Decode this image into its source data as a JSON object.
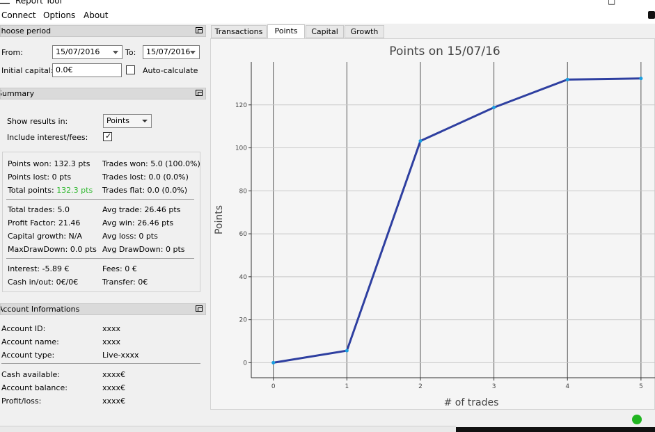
{
  "window": {
    "title": "Report Tool"
  },
  "menu": {
    "items": [
      "Connect",
      "Options",
      "About"
    ]
  },
  "choose_period": {
    "header": "Choose period",
    "from_label": "From:",
    "from_value": "15/07/2016",
    "to_label": "To:",
    "to_value": "15/07/2016",
    "capital_label": "Initial capital:",
    "capital_value": "0.0€",
    "auto_label": "Auto-calculate",
    "auto_checked": false
  },
  "summary": {
    "header": "Summary",
    "show_label": "Show results in:",
    "show_value": "Points",
    "include_label": "Include interest/fees:",
    "include_checked": true,
    "points_won": "Points won: 132.3 pts",
    "points_lost": "Points lost: 0 pts",
    "total_points_label": "Total points:",
    "total_points_value": "132.3 pts",
    "trades_won": "Trades won: 5.0 (100.0%)",
    "trades_lost": "Trades lost: 0.0 (0.0%)",
    "trades_flat": "Trades flat: 0.0 (0.0%)",
    "total_trades": "Total trades: 5.0",
    "profit_factor": "Profit Factor: 21.46",
    "capital_growth": "Capital growth: N/A",
    "max_drawdown": "MaxDrawDown: 0.0 pts",
    "avg_trade": "Avg trade: 26.46 pts",
    "avg_win": "Avg win: 26.46 pts",
    "avg_loss": "Avg loss: 0 pts",
    "avg_drawdown": "Avg DrawDown: 0 pts",
    "interest": "Interest: -5.89 €",
    "cash_in_out": "Cash in/out: 0€/0€",
    "fees": "Fees: 0 €",
    "transfer": "Transfer: 0€",
    "green_color": "#2eb82e"
  },
  "account": {
    "header": "Account Informations",
    "rows": [
      {
        "label": "Account ID:",
        "value": "xxxx"
      },
      {
        "label": "Account name:",
        "value": "xxxx"
      },
      {
        "label": "Account type:",
        "value": "Live-xxxx"
      },
      {
        "label": "Cash available:",
        "value": "xxxx€"
      },
      {
        "label": "Account balance:",
        "value": "xxxx€"
      },
      {
        "label": "Profit/loss:",
        "value": "xxxx€"
      }
    ]
  },
  "tabs": [
    {
      "label": "Transactions",
      "active": false
    },
    {
      "label": "Points",
      "active": true
    },
    {
      "label": "Capital",
      "active": false
    },
    {
      "label": "Growth",
      "active": false
    }
  ],
  "chart_data": {
    "type": "line",
    "title": "Points on 15/07/16",
    "xlabel": "# of trades",
    "ylabel": "Points",
    "x": [
      0,
      1,
      2,
      3,
      4,
      5
    ],
    "y": [
      0,
      5.6,
      103.2,
      118.8,
      131.8,
      132.3
    ],
    "xticks": [
      0,
      1,
      2,
      3,
      4,
      5
    ],
    "yticks": [
      0,
      20,
      40,
      60,
      80,
      100,
      120
    ],
    "xlim": [
      -0.3,
      5.2
    ],
    "ylim": [
      -7,
      140
    ],
    "grid": true,
    "line_color": "#2e3fa0",
    "point_color": "#1a9fe0"
  },
  "status": {
    "connection_color": "#21b521"
  }
}
